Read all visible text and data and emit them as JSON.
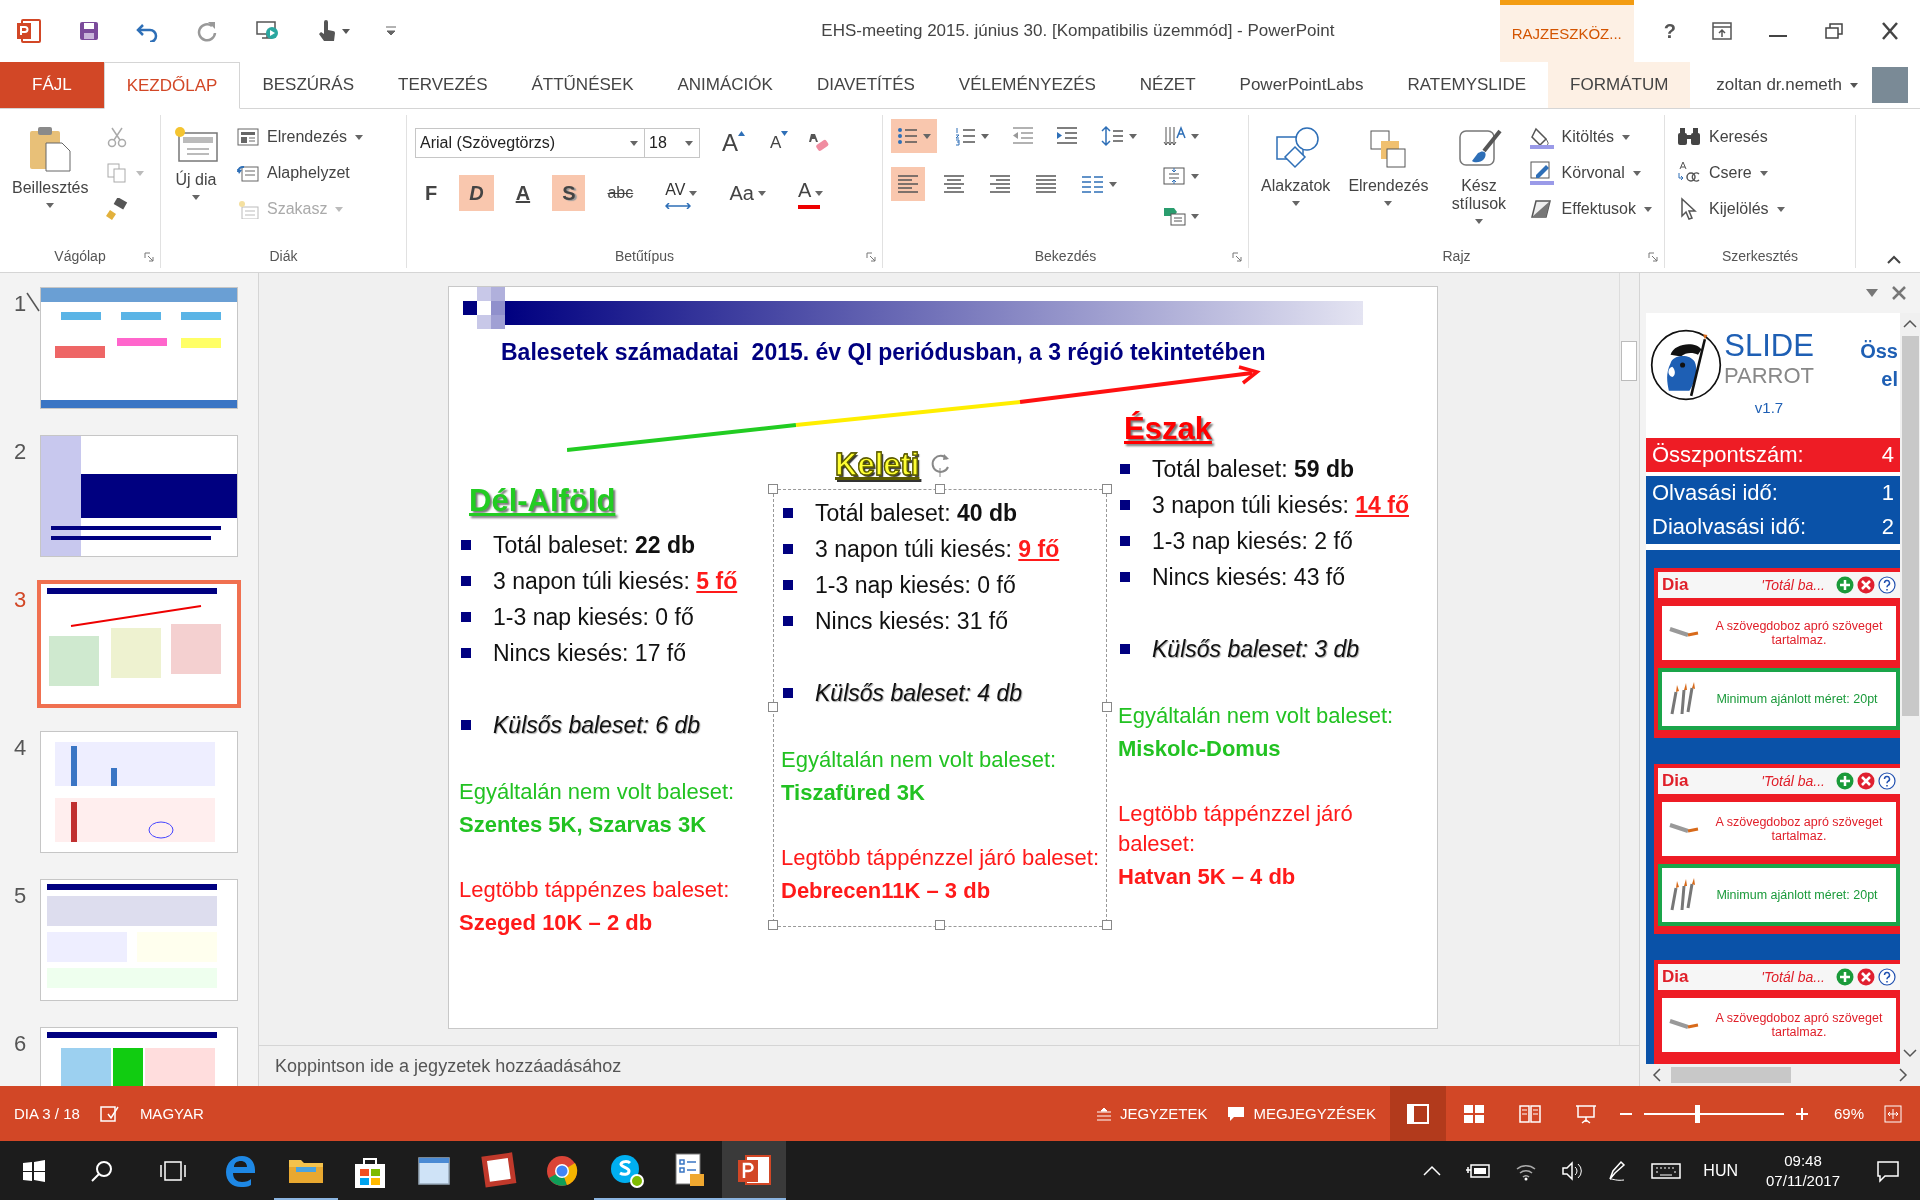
{
  "window": {
    "title": "EHS-meeting 2015. június 30. [Kompatibilis üzemmód] - PowerPoint",
    "context_tab": "RAJZESZKÖZ...",
    "help": "?"
  },
  "ribbon_tabs": [
    {
      "label": "FÁJL",
      "kind": "file",
      "selected": false
    },
    {
      "label": "KEZDŐLAP",
      "kind": "tab",
      "selected": true
    },
    {
      "label": "BESZÚRÁS",
      "kind": "tab",
      "selected": false
    },
    {
      "label": "TERVEZÉS",
      "kind": "tab",
      "selected": false
    },
    {
      "label": "ÁTTŰNÉSEK",
      "kind": "tab",
      "selected": false
    },
    {
      "label": "ANIMÁCIÓK",
      "kind": "tab",
      "selected": false
    },
    {
      "label": "DIAVETÍTÉS",
      "kind": "tab",
      "selected": false
    },
    {
      "label": "VÉLEMÉNYEZÉS",
      "kind": "tab",
      "selected": false
    },
    {
      "label": "NÉZET",
      "kind": "tab",
      "selected": false
    },
    {
      "label": "PowerPointLabs",
      "kind": "tab",
      "selected": false
    },
    {
      "label": "RATEMYSLIDE",
      "kind": "tab",
      "selected": false
    },
    {
      "label": "FORMÁTUM",
      "kind": "context",
      "selected": false
    }
  ],
  "user": {
    "name": "zoltan dr.nemeth"
  },
  "clipboard": {
    "label": "Vágólap",
    "launcher": true,
    "paste": "Beillesztés",
    "tools": [
      {
        "kind": "cut",
        "disabled": true
      },
      {
        "kind": "copy",
        "disabled": true
      },
      {
        "kind": "painter",
        "disabled": false
      }
    ]
  },
  "slides_group": {
    "label": "Diák",
    "launcher": false,
    "new_slide": "Új dia",
    "commands": [
      {
        "label": "Elrendezés",
        "kind": "layout",
        "disabled": false
      },
      {
        "label": "Alaphelyzet",
        "kind": "reset",
        "disabled": false
      },
      {
        "label": "Szakasz",
        "kind": "section",
        "disabled": true
      }
    ]
  },
  "font": {
    "label": "Betűtípus",
    "launcher": true,
    "face": "Arial (Szövegtörzs)",
    "size": "18",
    "grow": "A",
    "shrink": "A",
    "styles": [
      {
        "label": "F",
        "kind": "bold",
        "selected": false
      },
      {
        "label": "D",
        "kind": "italic",
        "selected": true
      },
      {
        "label": "A",
        "kind": "underline",
        "selected": false
      },
      {
        "label": "S",
        "kind": "shadow",
        "selected": true
      },
      {
        "label": "abc",
        "kind": "strike",
        "selected": false
      },
      {
        "label": "AV",
        "kind": "spacing",
        "selected": false
      },
      {
        "label": "Aa",
        "kind": "case",
        "selected": false
      },
      {
        "label": "A",
        "kind": "color",
        "selected": false
      }
    ]
  },
  "paragraph": {
    "label": "Bekezdés",
    "launcher": true,
    "lists": [
      {
        "kind": "bullets",
        "selected": true
      },
      {
        "kind": "numbering",
        "selected": false
      }
    ],
    "align": [
      {
        "kind": "left",
        "selected": true
      },
      {
        "kind": "center",
        "selected": false
      },
      {
        "kind": "right",
        "selected": false
      },
      {
        "kind": "justify",
        "selected": false
      }
    ]
  },
  "drawing": {
    "label": "Rajz",
    "launcher": true,
    "large": [
      "Alakzatok",
      "Elrendezés",
      "Kész stílusok"
    ],
    "small": [
      "Kitöltés",
      "Körvonal",
      "Effektusok"
    ]
  },
  "editing": {
    "label": "Szerkesztés",
    "launcher": false,
    "items": [
      "Keresés",
      "Csere",
      "Kijelölés"
    ]
  },
  "thumbnails": [
    {
      "number": "1",
      "selected": false,
      "hidden": true
    },
    {
      "number": "2",
      "selected": false,
      "hidden": false
    },
    {
      "number": "3",
      "selected": true,
      "hidden": false
    },
    {
      "number": "4",
      "selected": false,
      "hidden": false
    },
    {
      "number": "5",
      "selected": false,
      "hidden": false
    },
    {
      "number": "6",
      "selected": false,
      "hidden": false
    }
  ],
  "slide": {
    "title": "Balesetek számadatai  2015. év QI periódusban, a 3 régió tekintetében",
    "columns": [
      {
        "heading": "Dél-Alföld",
        "color": "#22cc22",
        "selected": false,
        "bullets": [
          {
            "label": "Totál baleset:",
            "value": "22 db",
            "kind": "bold"
          },
          {
            "label": "3 napon túli kiesés:",
            "value": "5 fő",
            "kind": "alert"
          },
          {
            "label": "1-3 nap kiesés: 0 fő",
            "kind": "plain"
          },
          {
            "label": "Nincs kiesés: 17 fő",
            "kind": "plain"
          },
          {
            "label": "Külsős baleset: 6 db",
            "kind": "italic"
          }
        ],
        "notes": [
          {
            "label": "Egyáltalán nem volt baleset:",
            "value": "Szentes 5K, Szarvas 3K",
            "kind": "positive"
          },
          {
            "label": "Legtöbb táppénzes baleset:",
            "value": "Szeged 10K – 2 db",
            "kind": "negative"
          }
        ]
      },
      {
        "heading": "Keleti",
        "color": "#ffff33",
        "selected": true,
        "bullets": [
          {
            "label": "Totál baleset:",
            "value": "40 db",
            "kind": "bold"
          },
          {
            "label": "3 napon túli kiesés:",
            "value": "9 fő",
            "kind": "alert"
          },
          {
            "label": "1-3 nap kiesés: 0 fő",
            "kind": "plain"
          },
          {
            "label": "Nincs kiesés: 31 fő",
            "kind": "plain"
          },
          {
            "label": "Külsős baleset: 4 db",
            "kind": "italic"
          }
        ],
        "notes": [
          {
            "label": "Egyáltalán nem volt baleset:",
            "value": "Tiszafüred 3K",
            "kind": "positive"
          },
          {
            "label": "Legtöbb táppénzzel járó baleset:",
            "value": "Debrecen11K – 3 db",
            "kind": "negative"
          }
        ]
      },
      {
        "heading": "Észak",
        "color": "#ff0000",
        "selected": false,
        "bullets": [
          {
            "label": "Totál baleset:",
            "value": "59 db",
            "kind": "bold"
          },
          {
            "label": "3 napon túli kiesés:",
            "value": "14 fő",
            "kind": "alert"
          },
          {
            "label": "1-3 nap kiesés: 2 fő",
            "kind": "plain"
          },
          {
            "label": "Nincs kiesés: 43 fő",
            "kind": "plain"
          },
          {
            "label": "Külsős baleset: 3 db",
            "kind": "italic"
          }
        ],
        "notes": [
          {
            "label": "Egyáltalán nem volt baleset:",
            "value": "Miskolc-Domus",
            "kind": "positive"
          },
          {
            "label": "Legtöbb táppénzzel járó baleset:",
            "value": "Hatvan 5K – 4 db",
            "kind": "negative"
          }
        ]
      }
    ]
  },
  "notes": {
    "placeholder": "Koppintson ide a jegyzetek hozzáadásához"
  },
  "addin_pane": {
    "logo_top": "SLIDE",
    "logo_bottom": "PARROT",
    "version": "v1.7",
    "heading_lines": [
      "Öss",
      "el"
    ],
    "scores": [
      {
        "label": "Összpontszám:",
        "value": "4",
        "kind": "total"
      },
      {
        "label": "Olvasási idő:",
        "value": "1",
        "kind": "time"
      },
      {
        "label": "Diaolvasási idő:",
        "value": "2",
        "kind": "time"
      }
    ],
    "cards": [
      {
        "title": "Dia",
        "subtitle": "'Totál ba...",
        "findings": [
          {
            "kind": "warning",
            "text": "A szövegdoboz apró szöveget tartalmaz."
          },
          {
            "kind": "tip",
            "text": "Minimum ajánlott méret: 20pt"
          }
        ]
      },
      {
        "title": "Dia",
        "subtitle": "'Totál ba...",
        "findings": [
          {
            "kind": "warning",
            "text": "A szövegdoboz apró szöveget tartalmaz."
          },
          {
            "kind": "tip",
            "text": "Minimum ajánlott méret: 20pt"
          }
        ]
      },
      {
        "title": "Dia",
        "subtitle": "'Totál ba...",
        "findings": [
          {
            "kind": "warning",
            "text": "A szövegdoboz apró szöveget tartalmaz."
          }
        ]
      }
    ]
  },
  "status_bar": {
    "slide": "DIA 3 / 18",
    "language": "MAGYAR",
    "notes": "JEGYZETEK",
    "comments": "MEGJEGYZÉSEK",
    "views": [
      {
        "kind": "normal",
        "selected": true
      },
      {
        "kind": "sorter",
        "selected": false
      },
      {
        "kind": "reading",
        "selected": false
      },
      {
        "kind": "show",
        "selected": false
      }
    ],
    "zoom": {
      "level": 0.38,
      "reading": "69%"
    }
  },
  "taskbar": {
    "apps": [
      {
        "kind": "browser",
        "selected": false,
        "running": false
      },
      {
        "kind": "folder",
        "selected": false,
        "running": true
      },
      {
        "kind": "bag",
        "selected": false,
        "running": false
      },
      {
        "kind": "window",
        "selected": false,
        "running": false
      },
      {
        "kind": "frame",
        "selected": false,
        "running": false
      },
      {
        "kind": "round",
        "selected": false,
        "running": false
      },
      {
        "kind": "chat",
        "selected": false,
        "running": true
      },
      {
        "kind": "form",
        "selected": false,
        "running": true
      },
      {
        "kind": "presentation",
        "selected": true,
        "running": true
      }
    ],
    "language": "HUN",
    "time": "09:48",
    "date": "07/11/2017"
  }
}
